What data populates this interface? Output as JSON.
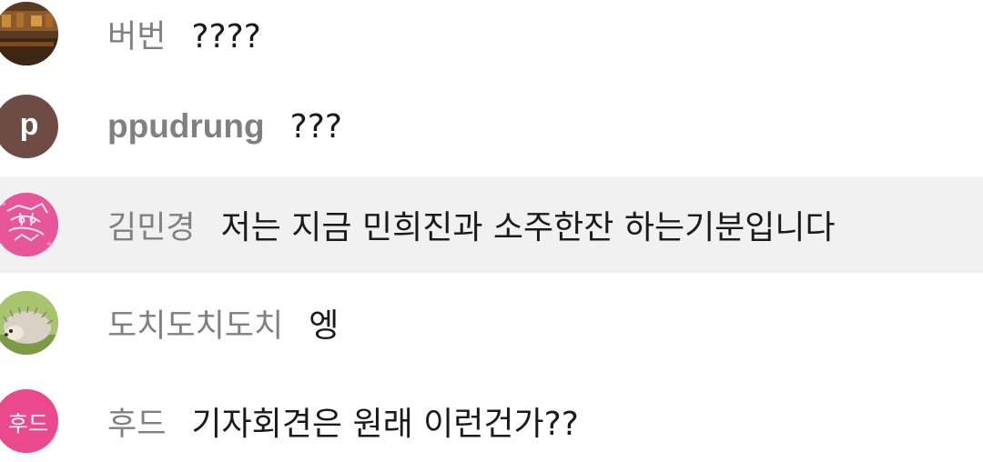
{
  "colors": {
    "name_text": "#808080",
    "message_text": "#1a1a1a",
    "highlight_row": "#f1f1f1",
    "avatar_p": "#6e4c44",
    "avatar_hood": "#ea4a8c",
    "avatar_tiger": "#e8569a",
    "avatar_photo": "#6b4423"
  },
  "messages": [
    {
      "avatar_icon": "photo-avatar-icon",
      "name": "버번",
      "text": "????"
    },
    {
      "avatar_icon": "letter-avatar",
      "avatar_letter": "p",
      "name": "ppudrung",
      "text": "???"
    },
    {
      "avatar_icon": "tiger-avatar-icon",
      "name": "김민경",
      "text": "저는 지금 민희진과 소주한잔 하는기분입니다"
    },
    {
      "avatar_icon": "hedgehog-avatar-icon",
      "name": "도치도치도치",
      "text": "엥"
    },
    {
      "avatar_icon": "letter-avatar",
      "avatar_letter": "후드",
      "name": "후드",
      "text": "기자회견은 원래 이런건가??"
    }
  ]
}
